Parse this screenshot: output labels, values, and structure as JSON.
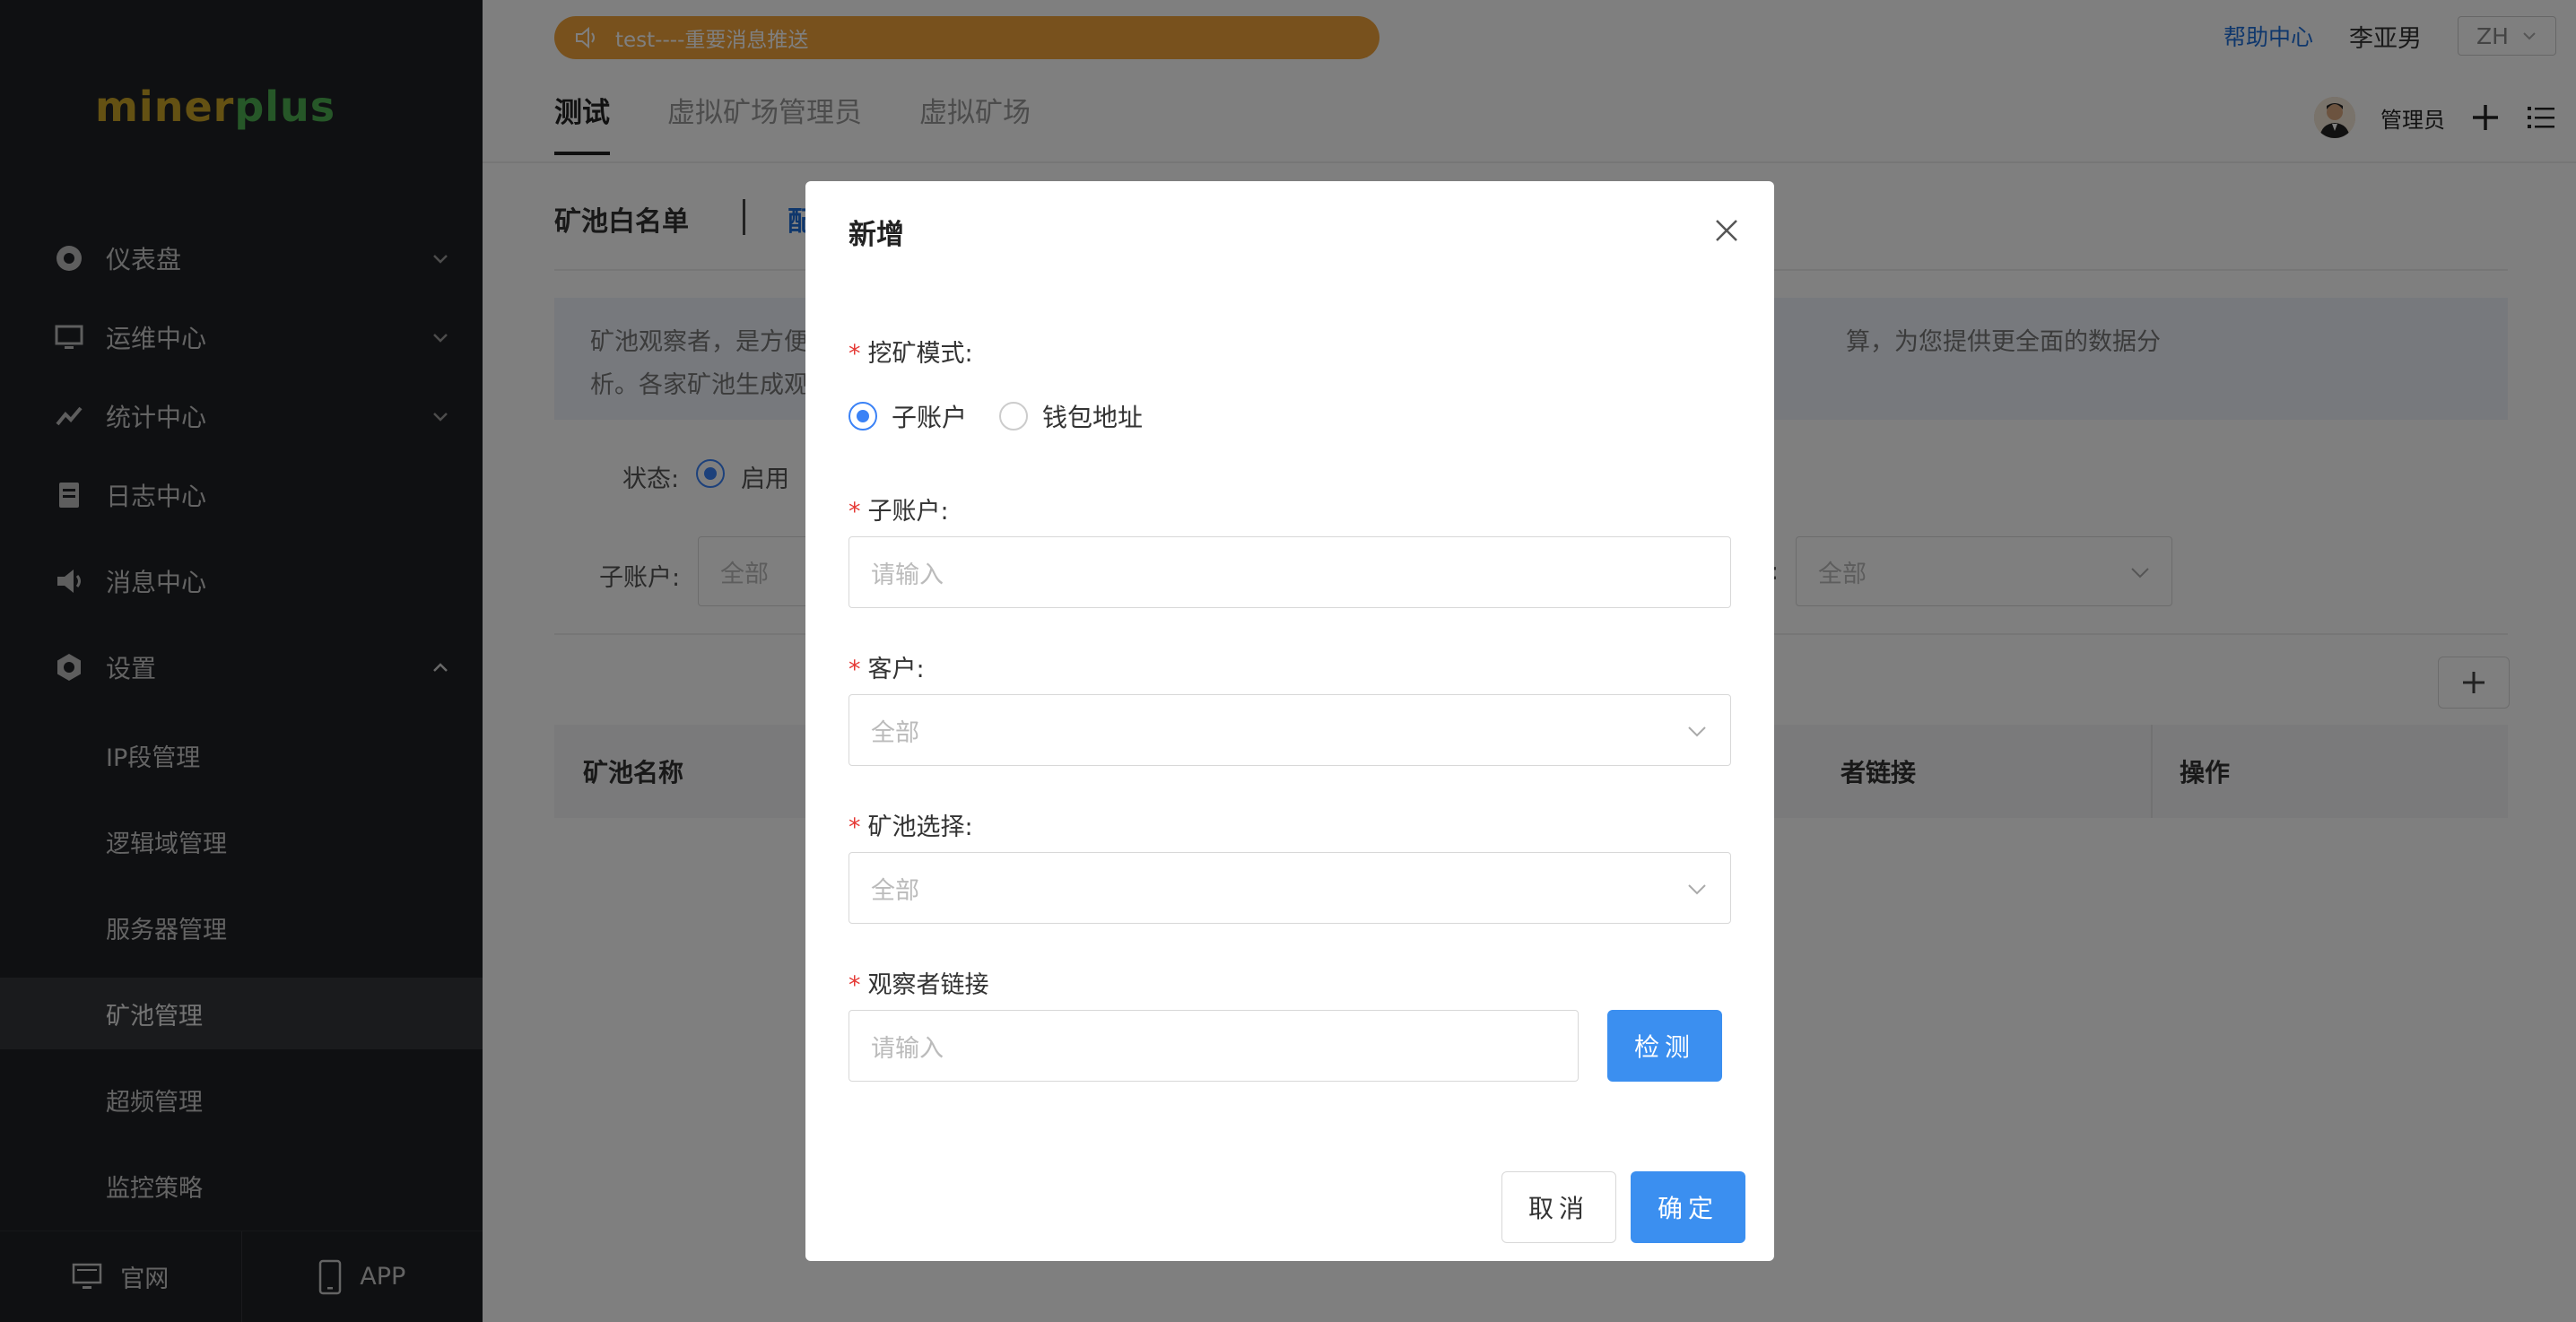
{
  "sidebar": {
    "logo_part1": "miner",
    "logo_part2": "plus",
    "menu": [
      {
        "label": "仪表盘"
      },
      {
        "label": "运维中心"
      },
      {
        "label": "统计中心"
      },
      {
        "label": "日志中心"
      },
      {
        "label": "消息中心"
      },
      {
        "label": "设置"
      }
    ],
    "submenu": [
      {
        "label": "IP段管理"
      },
      {
        "label": "逻辑域管理"
      },
      {
        "label": "服务器管理"
      },
      {
        "label": "矿池管理"
      },
      {
        "label": "超频管理"
      },
      {
        "label": "监控策略"
      }
    ],
    "footer": {
      "website": "官网",
      "app": "APP"
    }
  },
  "header": {
    "notice": "test----重要消息推送",
    "help": "帮助中心",
    "user": "李亚男",
    "lang": "ZH",
    "admin": "管理员",
    "tabs": [
      {
        "label": "测试"
      },
      {
        "label": "虚拟矿场管理员"
      },
      {
        "label": "虚拟矿场"
      }
    ]
  },
  "page": {
    "title": "矿池白名单",
    "title_tail": "配",
    "info_line1": "矿池观察者，是方便",
    "info_line1_end": "算，为您提供更全面的数据分",
    "info_line2": "析。各家矿池生成观",
    "filter_status_label": "状态:",
    "filter_status_value": "启用",
    "filter_subaccount_label": "子账户:",
    "filter_subaccount_value": "全部",
    "filter_other_colon": ":",
    "filter_other_value": "全部",
    "table_headers": {
      "pool_name": "矿池名称",
      "observer_link": "者链接",
      "actions": "操作"
    }
  },
  "modal": {
    "title": "新增",
    "mining_mode_label": "挖矿模式:",
    "mode_options": [
      {
        "label": "子账户",
        "checked": true
      },
      {
        "label": "钱包地址",
        "checked": false
      }
    ],
    "subaccount_label": "子账户:",
    "subaccount_placeholder": "请输入",
    "customer_label": "客户:",
    "customer_value": "全部",
    "pool_label": "矿池选择:",
    "pool_value": "全部",
    "observer_label": "观察者链接",
    "observer_placeholder": "请输入",
    "detect_button": "检测",
    "cancel_button": "取消",
    "confirm_button": "确定"
  },
  "colors": {
    "primary": "#3b8ff0",
    "sidebar_bg": "#1f2024",
    "notice_bg": "#f0a23a",
    "required": "#e53935"
  }
}
